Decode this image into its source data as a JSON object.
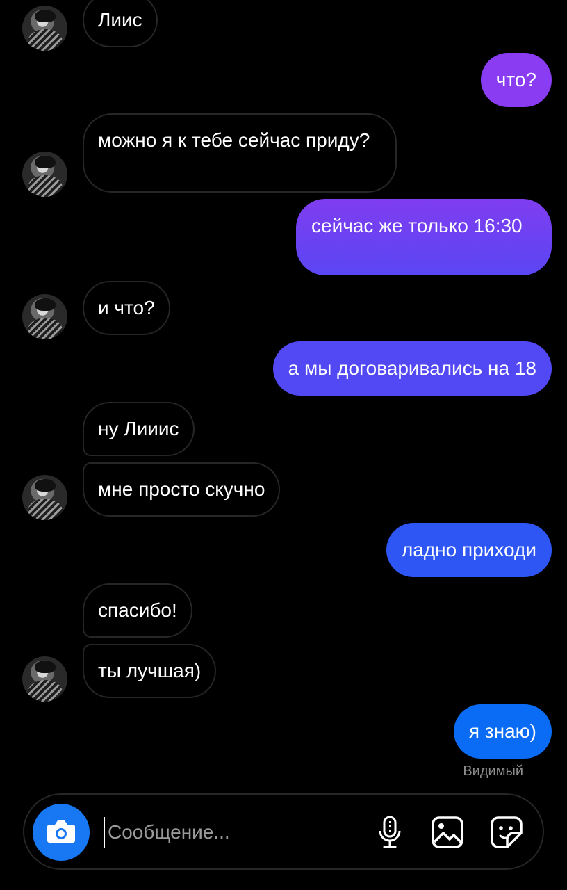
{
  "messages": [
    {
      "id": "m1",
      "direction": "incoming",
      "text": "Лиис"
    },
    {
      "id": "m2",
      "direction": "outgoing",
      "text": "что?"
    },
    {
      "id": "m3",
      "direction": "incoming",
      "text": "можно я к тебе сейчас приду?"
    },
    {
      "id": "m4",
      "direction": "outgoing",
      "text": "сейчас же только 16:30"
    },
    {
      "id": "m5",
      "direction": "incoming",
      "text": "и что?"
    },
    {
      "id": "m6",
      "direction": "outgoing",
      "text": "а мы договаривались на 18"
    },
    {
      "id": "m7",
      "direction": "incoming",
      "text": "ну Лииис"
    },
    {
      "id": "m8",
      "direction": "incoming",
      "text": "мне просто скучно"
    },
    {
      "id": "m9",
      "direction": "outgoing",
      "text": "ладно приходи"
    },
    {
      "id": "m10",
      "direction": "incoming",
      "text": "спасибо!"
    },
    {
      "id": "m11",
      "direction": "incoming",
      "text": "ты лучшая)"
    },
    {
      "id": "m12",
      "direction": "outgoing",
      "text": "я знаю)"
    }
  ],
  "seen_status": "Видимый",
  "composer": {
    "placeholder": "Сообщение...",
    "value": ""
  },
  "icons": {
    "camera": "camera-icon",
    "microphone": "microphone-icon",
    "gallery": "gallery-icon",
    "sticker": "sticker-icon"
  },
  "colors": {
    "background": "#000000",
    "incoming_border": "#262626",
    "outgoing_top": "#8a3cf2",
    "outgoing_bottom": "#0a6cf5",
    "accent": "#1877f2",
    "seen_text": "#8e8e8e"
  }
}
